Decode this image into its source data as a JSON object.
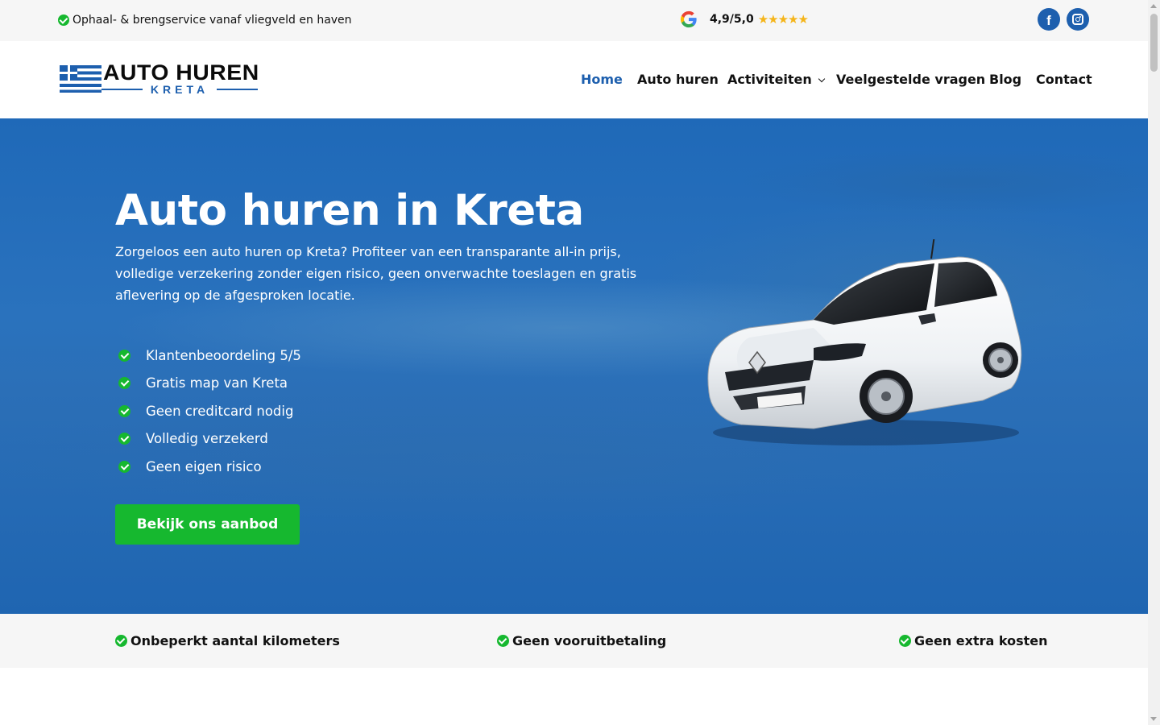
{
  "topbar": {
    "promo_text": "Ophaal- & brengservice vanaf vliegveld en haven",
    "rating_score": "4,9/5,0",
    "rating_stars": "★★★★★",
    "rating_value": 4.9,
    "social": [
      {
        "name": "facebook",
        "icon": "facebook-icon"
      },
      {
        "name": "instagram",
        "icon": "instagram-icon"
      }
    ]
  },
  "header": {
    "logo_title": "AUTO HUREN",
    "logo_subtitle": "KRETA",
    "nav": [
      {
        "label": "Home",
        "active": true
      },
      {
        "label": "Auto huren",
        "active": false
      },
      {
        "label": "Activiteiten",
        "active": false,
        "has_dropdown": true
      },
      {
        "label": "Veelgestelde vragen",
        "active": false
      },
      {
        "label": "Blog",
        "active": false
      },
      {
        "label": "Contact",
        "active": false
      }
    ]
  },
  "hero": {
    "title": "Auto huren in Kreta",
    "lede": "Zorgeloos een auto huren op Kreta? Profiteer van een transparante all-in prijs, volledige verzekering zonder eigen risico, geen onverwachte toeslagen en gratis aflevering op de afgesproken locatie.",
    "features": [
      "Klantenbeoordeling 5/5",
      "Gratis map van Kreta",
      "Geen creditcard nodig",
      "Volledig verzekerd",
      "Geen eigen risico"
    ],
    "cta_label": "Bekijk ons aanbod"
  },
  "benefits": [
    "Onbeperkt aantal kilometers",
    "Geen vooruitbetaling",
    "Geen extra kosten"
  ],
  "colors": {
    "brand_blue": "#1d5fae",
    "hero_blue": "#2a6fb8",
    "accent_green": "#16b82f",
    "star_yellow": "#f5b51a"
  }
}
